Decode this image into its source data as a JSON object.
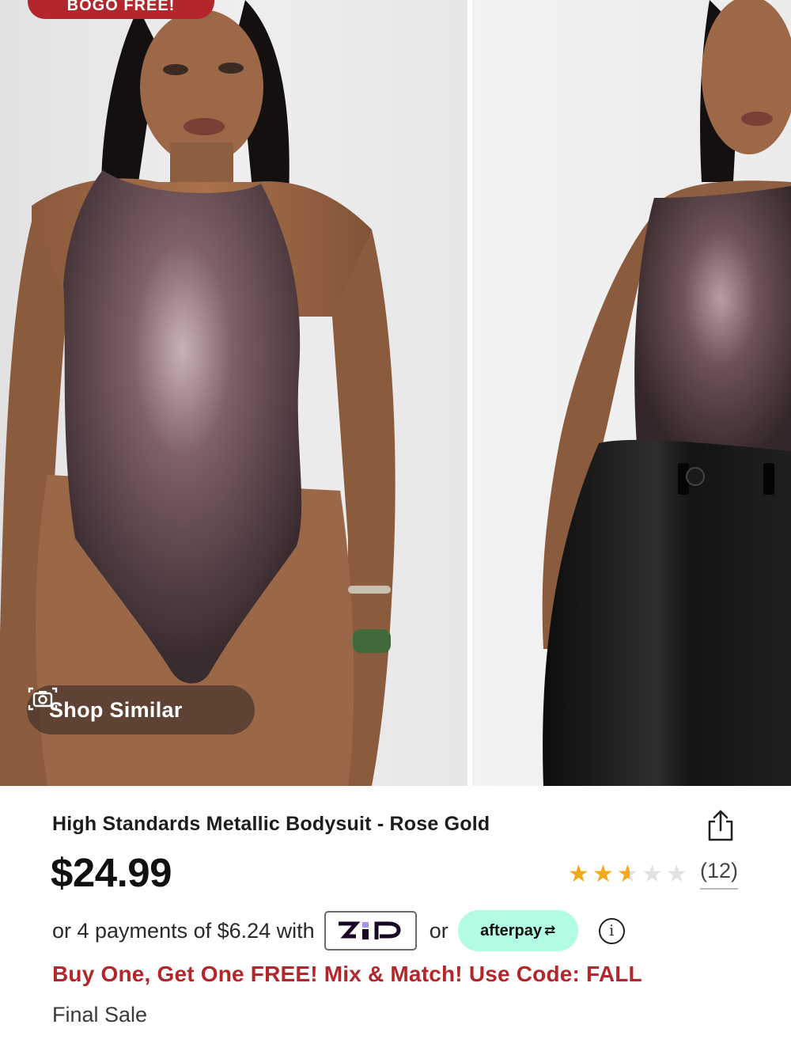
{
  "promo_tag": {
    "label": "BOGO FREE!"
  },
  "shop_similar": {
    "label": "Shop Similar",
    "icon": "camera-icon"
  },
  "product": {
    "title": "High Standards Metallic Bodysuit - Rose Gold",
    "price": "$24.99",
    "rating": {
      "value": 2.5,
      "max": 5,
      "review_count": "(12)"
    },
    "share_icon": "share-icon"
  },
  "payments": {
    "prefix": "or 4 payments of $6.24 with",
    "zip_label": "zip",
    "or_label": "or",
    "afterpay_label": "afterpay",
    "info_icon": "info-icon"
  },
  "promo_line": "Buy One, Get One FREE! Mix & Match! Use Code: FALL",
  "final_sale": "Final Sale",
  "colors": {
    "accent_red": "#b3262b",
    "star_gold": "#f2a91a",
    "afterpay_mint": "#b2fce4"
  }
}
